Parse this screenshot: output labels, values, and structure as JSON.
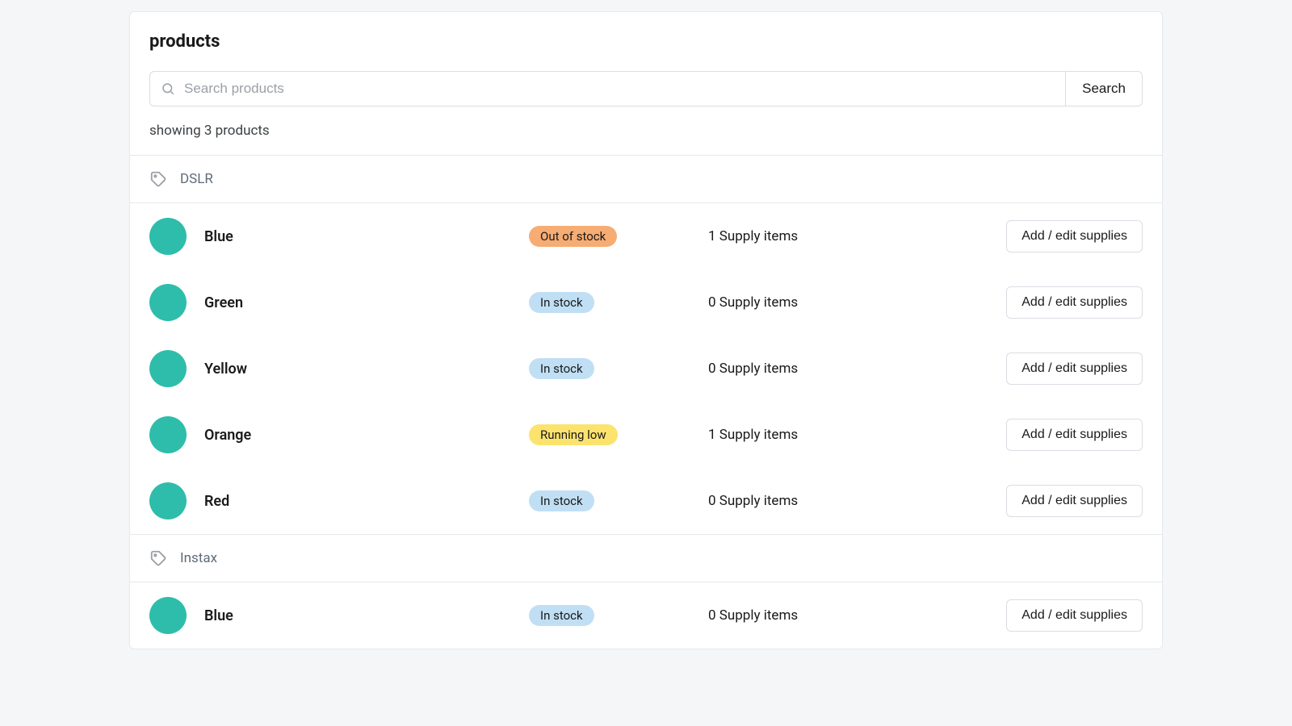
{
  "title": "products",
  "search": {
    "placeholder": "Search products",
    "button_label": "Search"
  },
  "result_count_text": "showing 3 products",
  "row_action_label": "Add / edit supplies",
  "supply_item_suffix": " Supply items",
  "status_labels": {
    "out_of_stock": "Out of stock",
    "in_stock": "In stock",
    "running_low": "Running low"
  },
  "groups": [
    {
      "label": "DSLR",
      "items": [
        {
          "name": "Blue",
          "status": "out_of_stock",
          "supply_count": 1
        },
        {
          "name": "Green",
          "status": "in_stock",
          "supply_count": 0
        },
        {
          "name": "Yellow",
          "status": "in_stock",
          "supply_count": 0
        },
        {
          "name": "Orange",
          "status": "running_low",
          "supply_count": 1
        },
        {
          "name": "Red",
          "status": "in_stock",
          "supply_count": 0
        }
      ]
    },
    {
      "label": "Instax",
      "items": [
        {
          "name": "Blue",
          "status": "in_stock",
          "supply_count": 0
        }
      ]
    }
  ]
}
